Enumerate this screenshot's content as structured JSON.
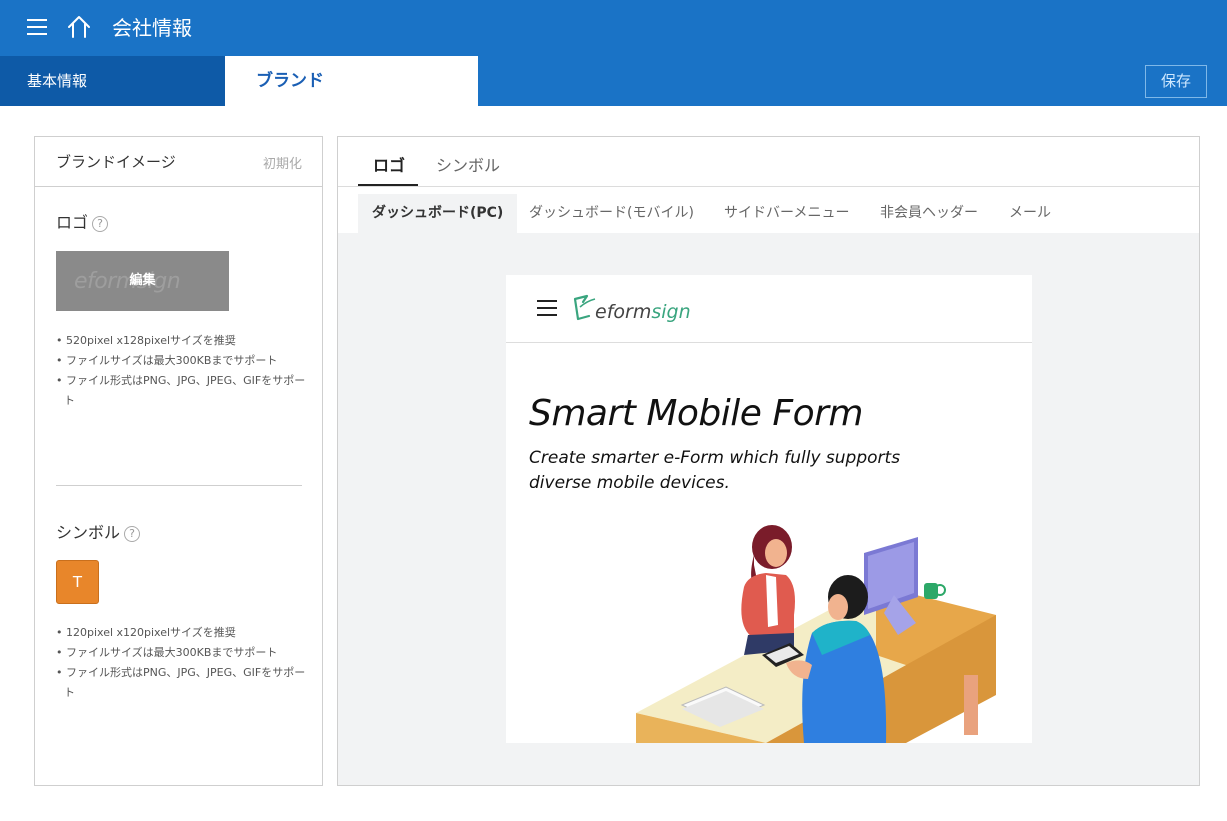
{
  "header": {
    "title": "会社情報"
  },
  "tabs": {
    "basic": "基本情報",
    "brand": "ブランド",
    "save": "保存"
  },
  "left": {
    "title": "ブランドイメージ",
    "reset": "初期化",
    "logo": {
      "label": "ロゴ",
      "help": "?",
      "edit": "編集",
      "ghost": "eformsign",
      "notes": [
        "• 520pixel x128pixelサイズを推奨",
        "• ファイルサイズは最大300KBまでサポート",
        "• ファイル形式はPNG、JPG、JPEG、GIFをサポート"
      ]
    },
    "symbol": {
      "label": "シンボル",
      "help": "?",
      "letter": "T",
      "color": "#e8862a",
      "notes": [
        "• 120pixel x120pixelサイズを推奨",
        "• ファイルサイズは最大300KBまでサポート",
        "• ファイル形式はPNG、JPG、JPEG、GIFをサポート"
      ]
    }
  },
  "right": {
    "tabs": [
      "ロゴ",
      "シンボル"
    ],
    "subtabs": [
      "ダッシュボード(PC)",
      "ダッシュボード(モバイル)",
      "サイドバーメニュー",
      "非会員ヘッダー",
      "メール"
    ]
  },
  "preview": {
    "logo_text": "eformsign",
    "heading": "Smart Mobile Form",
    "subheading": "Create smarter e-Form which fully supports diverse mobile devices."
  },
  "colors": {
    "topbar": "#1a73c6",
    "tab_dark": "#0e5aa7",
    "accent_logo": "#3aa57f"
  }
}
